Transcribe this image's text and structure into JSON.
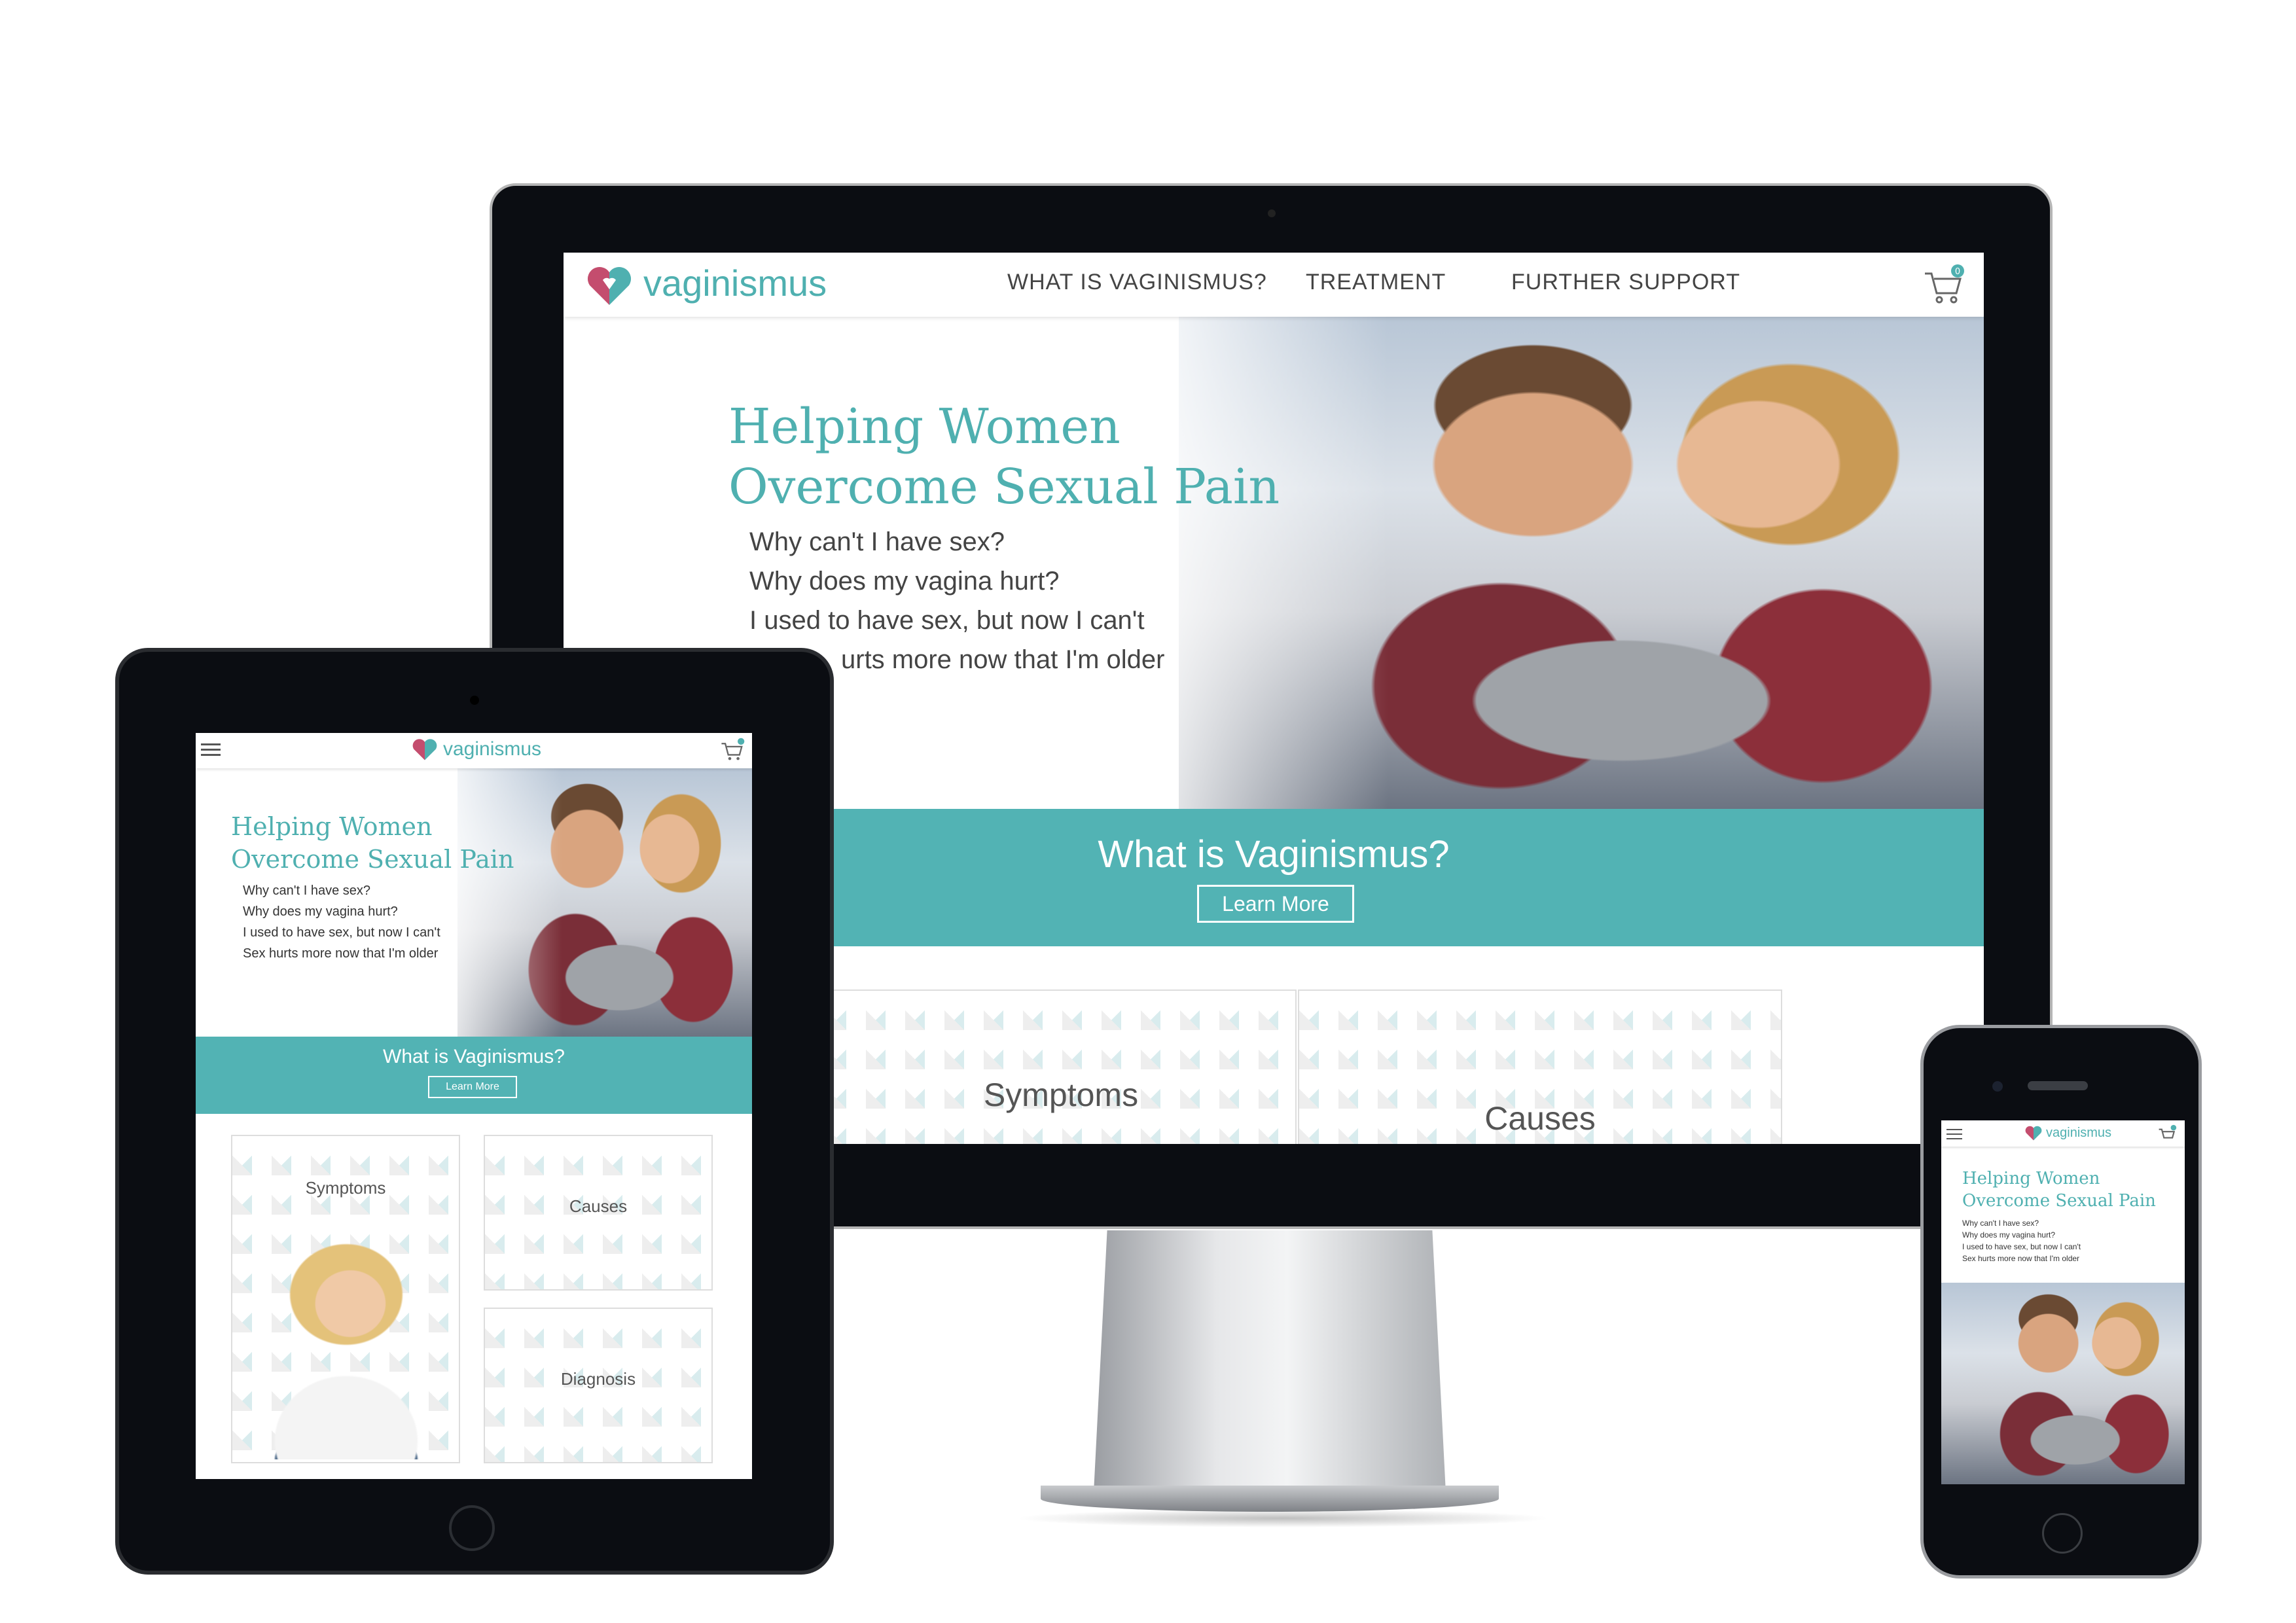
{
  "brand": {
    "name": "vaginismus",
    "teal": "#4fb0b0",
    "band_teal": "#52b3b4"
  },
  "nav": {
    "links": [
      "WHAT IS VAGINISMUS?",
      "TREATMENT",
      "FURTHER SUPPORT"
    ],
    "cart_count": "0",
    "icons": {
      "menu": "hamburger-icon",
      "cart": "cart-icon",
      "logo": "heart-logo-icon"
    }
  },
  "hero": {
    "title_line1": "Helping Women",
    "title_line2": "Overcome Sexual Pain",
    "title_full": "Helping Women Overcome Sexual Pain",
    "questions": [
      "Why can't I have sex?",
      "Why does my vagina hurt?",
      "I used to have sex, but now I can't",
      "Sex hurts more now that I'm older"
    ],
    "desktop_q4_visible": "urts more now that I'm older",
    "tablet_q3": "I used to have sex, but now I can't"
  },
  "band": {
    "title": "What is Vaginismus?",
    "button": "Learn More"
  },
  "cards": {
    "symptoms": "Symptoms",
    "causes": "Causes",
    "diagnosis": "Diagnosis"
  }
}
